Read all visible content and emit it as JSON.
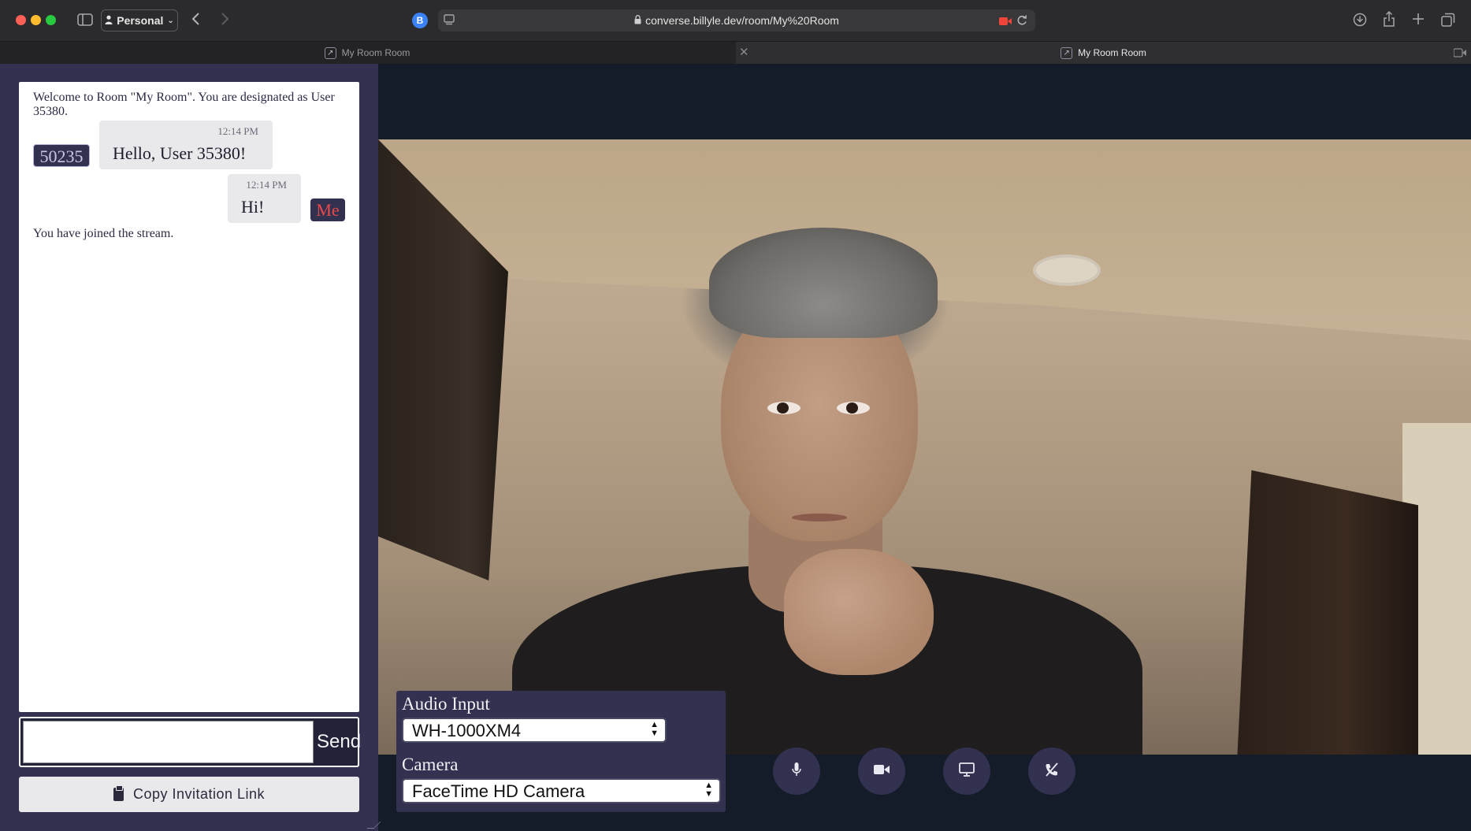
{
  "browser": {
    "profile_label": "Personal",
    "bitwarden_letter": "B",
    "url": "converse.billyle.dev/room/My%20Room",
    "tabs": [
      {
        "label": "My Room Room",
        "active": false
      },
      {
        "label": "My Room Room",
        "active": true
      }
    ]
  },
  "chat": {
    "messages": [
      {
        "type": "system",
        "text": "Welcome to Room \"My Room\". You are designated as User 35380."
      },
      {
        "type": "incoming",
        "user": "50235",
        "time": "12:14 PM",
        "text": "Hello, User 35380!"
      },
      {
        "type": "outgoing",
        "user": "Me",
        "time": "12:14 PM",
        "text": "Hi!"
      },
      {
        "type": "system",
        "text": "You have joined the stream."
      }
    ],
    "input_value": "",
    "send_label": "Send",
    "invite_label": "Copy Invitation Link"
  },
  "devices": {
    "audio_label": "Audio Input",
    "audio_value": "WH-1000XM4",
    "camera_label": "Camera",
    "camera_value": "FaceTime HD Camera"
  },
  "controls": [
    {
      "icon": "microphone-icon"
    },
    {
      "icon": "video-camera-icon"
    },
    {
      "icon": "screen-share-icon"
    },
    {
      "icon": "hang-up-icon"
    }
  ],
  "colors": {
    "sidebar": "#323150",
    "stage": "#141c29",
    "me_badge_text": "#e64a4a"
  }
}
